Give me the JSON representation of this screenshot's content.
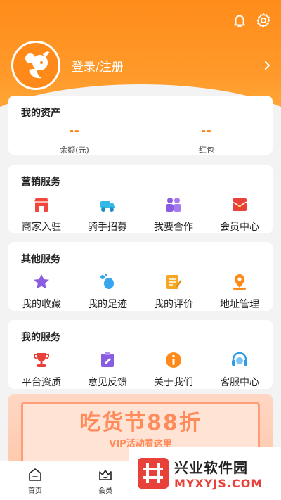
{
  "header": {
    "login_label": "登录/注册",
    "icons": [
      "bell-icon",
      "settings-icon",
      "chevron-right-icon"
    ],
    "color_primary": "#ff8c1a"
  },
  "assets": {
    "title": "我的资产",
    "items": [
      {
        "value": "--",
        "label": "余额(元)"
      },
      {
        "value": "--",
        "label": "红包"
      }
    ]
  },
  "marketing": {
    "title": "营销服务",
    "items": [
      {
        "label": "商家入驻",
        "icon": "store-icon"
      },
      {
        "label": "骑手招募",
        "icon": "scooter-icon"
      },
      {
        "label": "我要合作",
        "icon": "partners-icon"
      },
      {
        "label": "会员中心",
        "icon": "member-card-icon"
      }
    ]
  },
  "other": {
    "title": "其他服务",
    "items": [
      {
        "label": "我的收藏",
        "icon": "star-icon"
      },
      {
        "label": "我的足迹",
        "icon": "footprint-icon"
      },
      {
        "label": "我的评价",
        "icon": "review-icon"
      },
      {
        "label": "地址管理",
        "icon": "location-icon"
      }
    ]
  },
  "mine": {
    "title": "我的服务",
    "items": [
      {
        "label": "平台资质",
        "icon": "trophy-icon"
      },
      {
        "label": "意见反馈",
        "icon": "feedback-icon"
      },
      {
        "label": "关于我们",
        "icon": "info-icon"
      },
      {
        "label": "客服中心",
        "icon": "headset-icon"
      }
    ]
  },
  "banner": {
    "title": "吃货节88折",
    "subtitle": "VIP活动看这里"
  },
  "tabbar": {
    "items": [
      {
        "label": "首页",
        "icon": "home-icon"
      },
      {
        "label": "会员",
        "icon": "crown-icon"
      }
    ]
  },
  "watermark": {
    "name_cn": "兴业软件园",
    "name_en": "MYXYJS.COM"
  }
}
